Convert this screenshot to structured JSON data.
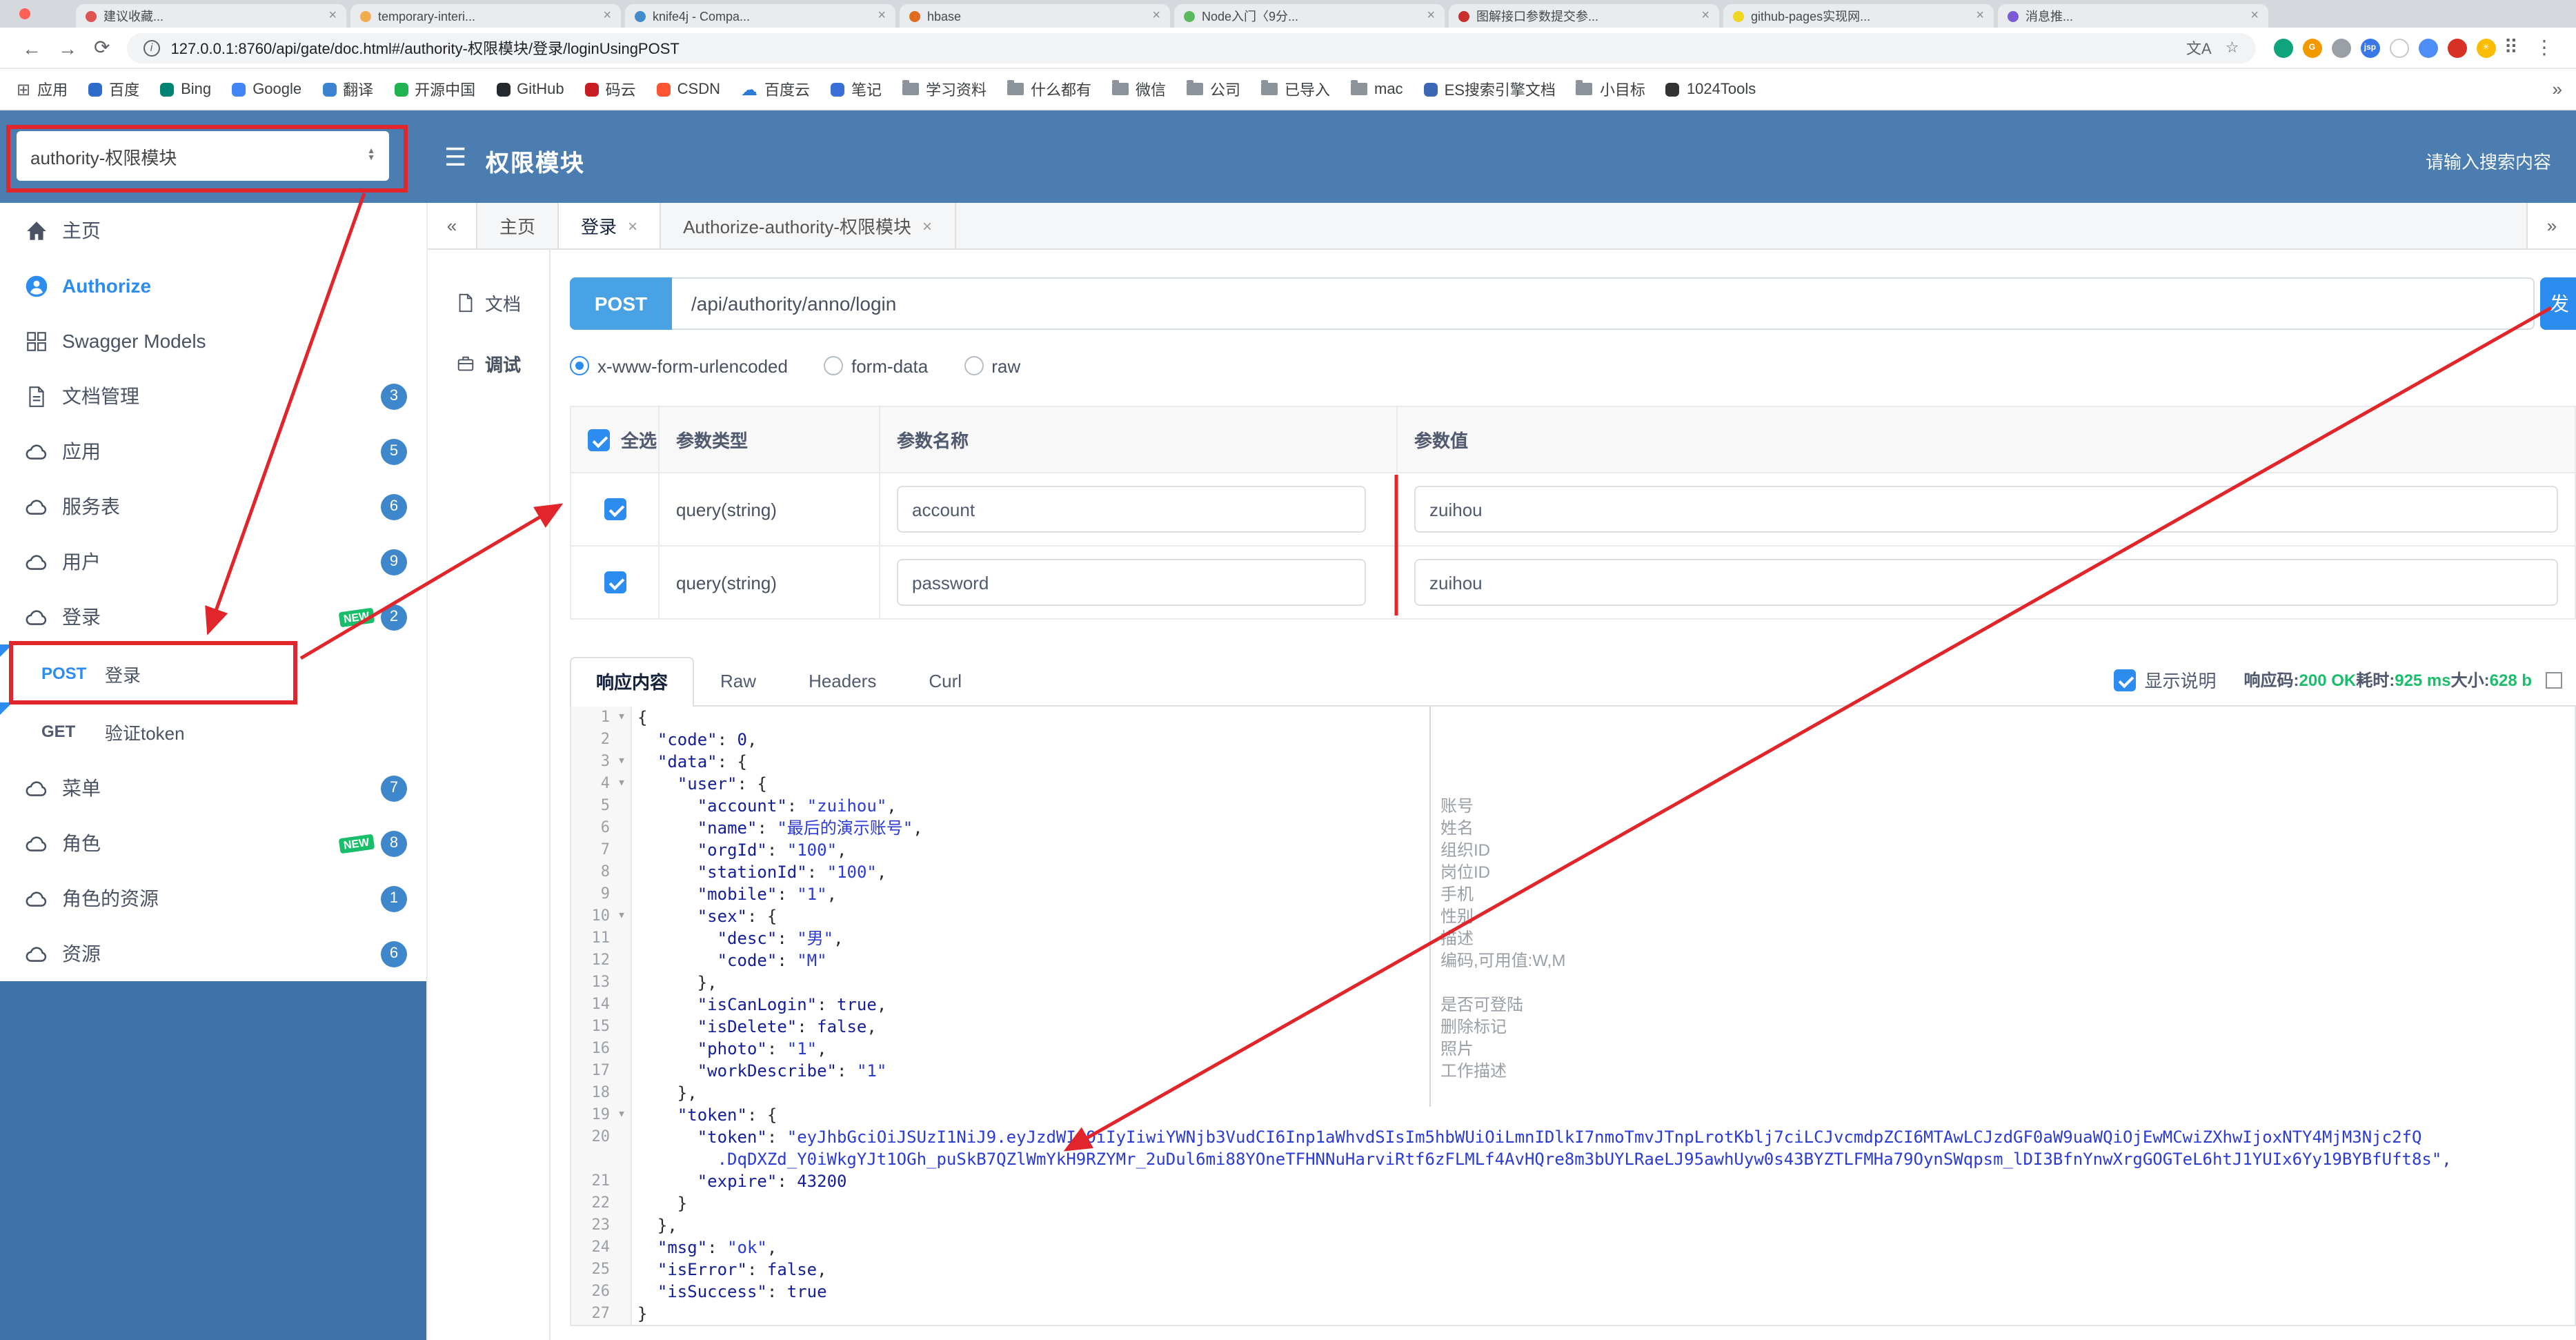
{
  "colors": {
    "accent": "#2d8cf0",
    "header_blue": "#4b7db1",
    "sidebar_blue": "#3f72a6",
    "method_badge_blue": "#49a2e4",
    "success_green": "#19be6b",
    "new_tag_green": "#19be6b",
    "annotation_red": "#e0262a"
  },
  "browser": {
    "window_tabs": [
      {
        "title": "建议收藏...",
        "favicon": "#e05252"
      },
      {
        "title": "temporary-interi...",
        "favicon": "#f0ad4e"
      },
      {
        "title": "knife4j - Compa...",
        "favicon": "#428bca"
      },
      {
        "title": "hbase",
        "favicon": "#e06c1f"
      },
      {
        "title": "Node入门〈9分...",
        "favicon": "#5cb85c"
      },
      {
        "title": "图解接口参数提交参...",
        "favicon": "#c9302c"
      },
      {
        "title": "github-pages实现网...",
        "favicon": "#f0d722"
      },
      {
        "title": "消息推...",
        "favicon": "#7b5cd6"
      }
    ],
    "toolbar": {
      "url": "127.0.0.1:8760/api/gate/doc.html#/authority-权限模块/登录/loginUsingPOST",
      "extensions": [
        {
          "color": "#0fa47c",
          "label": ""
        },
        {
          "color": "#f29900",
          "label": "G"
        },
        {
          "color": "#9aa0a6",
          "label": ""
        },
        {
          "color": "#3b78e7",
          "label": "jsp"
        },
        {
          "color": "#ffffff",
          "label": "",
          "border": true
        },
        {
          "color": "#4f8ef7",
          "label": ""
        },
        {
          "color": "#d93025",
          "label": ""
        },
        {
          "color": "#fbbc05",
          "label": "✳"
        }
      ]
    },
    "bookmarks": [
      {
        "label": "应用",
        "icon": "apps"
      },
      {
        "label": "百度",
        "icon": "dot",
        "color": "#2d6ccb"
      },
      {
        "label": "Bing",
        "icon": "dot",
        "color": "#008373"
      },
      {
        "label": "Google",
        "icon": "dot",
        "color": "#4285f4"
      },
      {
        "label": "翻译",
        "icon": "dot",
        "color": "#3b82d0"
      },
      {
        "label": "开源中国",
        "icon": "dot",
        "color": "#21b351"
      },
      {
        "label": "GitHub",
        "icon": "dot",
        "color": "#24292e"
      },
      {
        "label": "码云",
        "icon": "dot",
        "color": "#c71d23"
      },
      {
        "label": "CSDN",
        "icon": "dot",
        "color": "#fc5531"
      },
      {
        "label": "百度云",
        "icon": "cloud",
        "color": "#2b7bd6"
      },
      {
        "label": "笔记",
        "icon": "dot",
        "color": "#3a6fd8"
      },
      {
        "label": "学习资料",
        "icon": "folder"
      },
      {
        "label": "什么都有",
        "icon": "folder"
      },
      {
        "label": "微信",
        "icon": "folder"
      },
      {
        "label": "公司",
        "icon": "folder"
      },
      {
        "label": "已导入",
        "icon": "folder"
      },
      {
        "label": "mac",
        "icon": "folder"
      },
      {
        "label": "ES搜索引擎文档",
        "icon": "dot",
        "color": "#3b67b5"
      },
      {
        "label": "小目标",
        "icon": "folder"
      },
      {
        "label": "1024Tools",
        "icon": "dot",
        "color": "#333333"
      }
    ],
    "bookmarks_overflow": "»"
  },
  "header": {
    "group_select_value": "authority-权限模块",
    "title": "权限模块",
    "search_placeholder": "请输入搜索内容"
  },
  "sidebar": {
    "items": [
      {
        "label": "主页",
        "icon": "home"
      },
      {
        "label": "Authorize",
        "icon": "auth",
        "accent": true
      },
      {
        "label": "Swagger Models",
        "icon": "models"
      },
      {
        "label": "文档管理",
        "icon": "docs",
        "badge": "3"
      },
      {
        "label": "应用",
        "icon": "cloud",
        "badge": "5"
      },
      {
        "label": "服务表",
        "icon": "cloud",
        "badge": "6"
      },
      {
        "label": "用户",
        "icon": "cloud",
        "badge": "9"
      },
      {
        "label": "登录",
        "icon": "cloud",
        "badge": "2",
        "new": true,
        "expanded": true
      },
      {
        "label": "菜单",
        "icon": "cloud",
        "badge": "7"
      },
      {
        "label": "角色",
        "icon": "cloud",
        "badge": "8",
        "new": true
      },
      {
        "label": "角色的资源",
        "icon": "cloud",
        "badge": "1"
      },
      {
        "label": "资源",
        "icon": "cloud",
        "badge": "6"
      }
    ],
    "api_items": [
      {
        "method": "POST",
        "label": "登录"
      },
      {
        "method": "GET",
        "label": "验证token"
      }
    ]
  },
  "workspace": {
    "collapse_left": "«",
    "collapse_right": "»",
    "tabs": [
      {
        "label": "主页",
        "closable": false
      },
      {
        "label": "登录",
        "closable": true,
        "active": true
      },
      {
        "label": "Authorize-authority-权限模块",
        "closable": true
      }
    ]
  },
  "doc_side_tabs": [
    {
      "label": "文档",
      "icon": "doc"
    },
    {
      "label": "调试",
      "icon": "debug",
      "active": true
    }
  ],
  "request": {
    "method": "POST",
    "path": "/api/authority/anno/login",
    "send_button": "发",
    "content_types": [
      {
        "label": "x-www-form-urlencoded",
        "selected": true
      },
      {
        "label": "form-data",
        "selected": false
      },
      {
        "label": "raw",
        "selected": false
      }
    ],
    "params": {
      "headers": {
        "select_all": "全选",
        "type": "参数类型",
        "name": "参数名称",
        "value": "参数值"
      },
      "rows": [
        {
          "checked": true,
          "type": "query(string)",
          "name": "account",
          "value": "zuihou"
        },
        {
          "checked": true,
          "type": "query(string)",
          "name": "password",
          "value": "zuihou"
        }
      ]
    }
  },
  "response": {
    "tabs": [
      {
        "label": "响应内容",
        "active": true
      },
      {
        "label": "Raw",
        "active": false
      },
      {
        "label": "Headers",
        "active": false
      },
      {
        "label": "Curl",
        "active": false
      }
    ],
    "show_description_label": "显示说明",
    "meta": {
      "status_label": "响应码:",
      "status_value": "200 OK",
      "time_label": "耗时:",
      "time_value": "925 ms",
      "size_label": "大小:",
      "size_value": "628 b"
    },
    "code_lines": [
      {
        "num": 1,
        "fold": true,
        "text": "{"
      },
      {
        "num": 2,
        "text": "  \"code\": 0,"
      },
      {
        "num": 3,
        "fold": true,
        "text": "  \"data\": {"
      },
      {
        "num": 4,
        "fold": true,
        "text": "    \"user\": {"
      },
      {
        "num": 5,
        "text": "      \"account\": \"zuihou\",",
        "comment": "账号"
      },
      {
        "num": 6,
        "text": "      \"name\": \"最后的演示账号\",",
        "comment": "姓名"
      },
      {
        "num": 7,
        "text": "      \"orgId\": \"100\",",
        "comment": "组织ID"
      },
      {
        "num": 8,
        "text": "      \"stationId\": \"100\",",
        "comment": "岗位ID"
      },
      {
        "num": 9,
        "text": "      \"mobile\": \"1\",",
        "comment": "手机"
      },
      {
        "num": 10,
        "fold": true,
        "text": "      \"sex\": {",
        "comment": "性别"
      },
      {
        "num": 11,
        "text": "        \"desc\": \"男\",",
        "comment": "描述"
      },
      {
        "num": 12,
        "text": "        \"code\": \"M\"",
        "comment": "编码,可用值:W,M"
      },
      {
        "num": 13,
        "text": "      },"
      },
      {
        "num": 14,
        "text": "      \"isCanLogin\": true,",
        "comment": "是否可登陆"
      },
      {
        "num": 15,
        "text": "      \"isDelete\": false,",
        "comment": "删除标记"
      },
      {
        "num": 16,
        "text": "      \"photo\": \"1\",",
        "comment": "照片"
      },
      {
        "num": 17,
        "text": "      \"workDescribe\": \"1\"",
        "comment": "工作描述"
      },
      {
        "num": 18,
        "text": "    },"
      },
      {
        "num": 19,
        "fold": true,
        "text": "    \"token\": {"
      },
      {
        "num": 20,
        "text": "      \"token\": \"eyJhbGciOiJSUzI1NiJ9.eyJzdWIiOiIyIiwiYWNjb3VudCI6Inp1aWhvdSIsIm5hbWUiOiLmnIDlkI7nmoTmvJTnpLrotKblj7ciLCJvcmdpZCI6MTAwLCJzdGF0aW9uaWQiOjEwMCwiZXhwIjoxNTY4MjM3Njc2fQ",
        "wrap": "        .DqDXZd_Y0iWkgYJt1OGh_puSkB7QZlWmYkH9RZYMr_2uDul6mi88YOneTFHNNuHarviRtf6zFLMLf4AvHQre8m3bUYLRaeLJ95awhUyw0s43BYZTLFMHa79OynSWqpsm_lDI3BfnYnwXrgGOGTeL6htJ1YUIx6Yy19BYBfUft8s\","
      },
      {
        "num": 21,
        "text": "      \"expire\": 43200"
      },
      {
        "num": 22,
        "text": "    }"
      },
      {
        "num": 23,
        "text": "  },"
      },
      {
        "num": 24,
        "text": "  \"msg\": \"ok\","
      },
      {
        "num": 25,
        "text": "  \"isError\": false,"
      },
      {
        "num": 26,
        "text": "  \"isSuccess\": true"
      },
      {
        "num": 27,
        "text": "}"
      }
    ]
  }
}
